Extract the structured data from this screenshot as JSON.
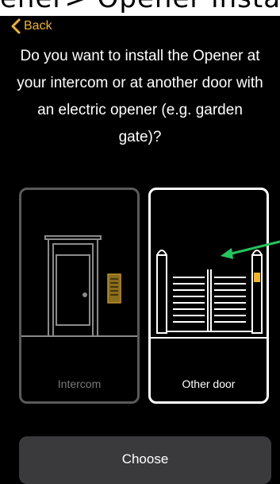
{
  "banner": {
    "text": "ener> Opener installieren."
  },
  "nav": {
    "back_label": "Back"
  },
  "question": {
    "text": "Do you want to install the Opener at your intercom or at another door with an electric opener (e.g. garden gate)?"
  },
  "options": [
    {
      "label": "Intercom",
      "selected": false
    },
    {
      "label": "Other door",
      "selected": true
    }
  ],
  "actions": {
    "choose_label": "Choose"
  },
  "colors": {
    "accent": "#f0b429",
    "selected_border": "#ffffff",
    "unselected_border": "#5a5a5a",
    "button_bg": "#3a3a3c",
    "annotation_arrow": "#22c55e"
  }
}
